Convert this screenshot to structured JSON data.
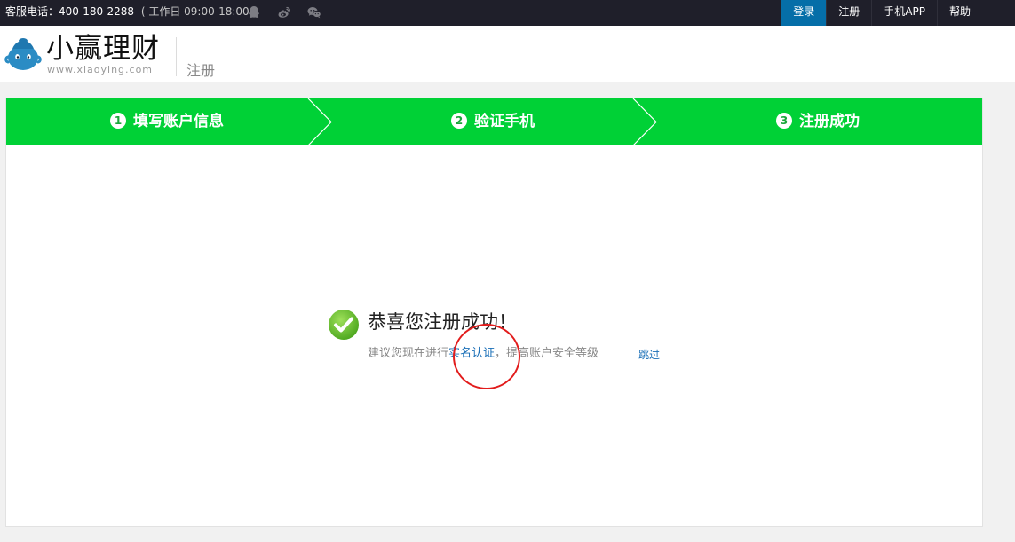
{
  "topbar": {
    "hotline_label": "客服电话：400-180-2288",
    "hours": "( 工作日 09:00-18:00 )",
    "social_icons": [
      "qq-icon",
      "weibo-icon",
      "wechat-icon"
    ],
    "nav": [
      {
        "label": "登录",
        "active": true
      },
      {
        "label": "注册",
        "active": false
      },
      {
        "label": "手机APP",
        "active": false
      },
      {
        "label": "帮助",
        "active": false
      }
    ],
    "bg_color": "#1f1f2a",
    "active_color": "#056ea8"
  },
  "header": {
    "brand": "小赢理财",
    "domain": "www.xiaoying.com",
    "page_title": "注册"
  },
  "steps": [
    {
      "num": "1",
      "label": "填写账户信息"
    },
    {
      "num": "2",
      "label": "验证手机"
    },
    {
      "num": "3",
      "label": "注册成功"
    }
  ],
  "step_color": "#00d136",
  "result": {
    "title": "恭喜您注册成功！",
    "hint_prefix": "建议您现在进行",
    "hint_link": "实名认证",
    "hint_suffix": "，提高账户安全等级",
    "skip": "跳过"
  }
}
